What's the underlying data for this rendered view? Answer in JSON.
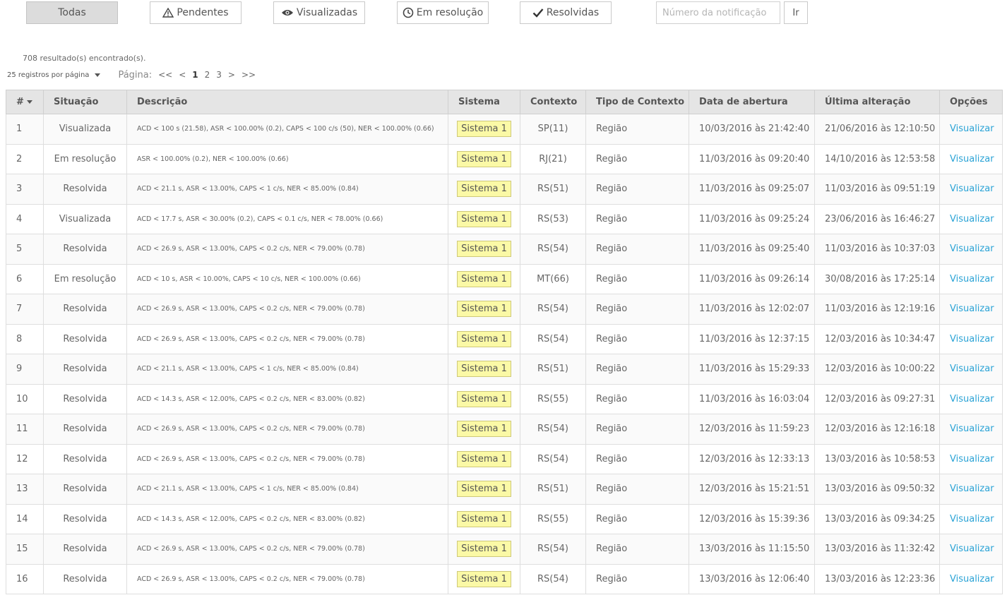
{
  "filters": {
    "todas": "Todas",
    "pendentes": "Pendentes",
    "visualizadas": "Visualizadas",
    "em_resolucao": "Em resolução",
    "resolvidas": "Resolvidas",
    "search_placeholder": "Número da notificação",
    "go_label": "Ir"
  },
  "results_text": "708 resultado(s) encontrado(s).",
  "per_page_label": "25 registros por página",
  "pagination": {
    "label": "Página:",
    "first": "<<",
    "prev": "<",
    "pages": [
      "1",
      "2",
      "3"
    ],
    "next": ">",
    "last": ">>"
  },
  "table": {
    "headers": [
      "#",
      "Situação",
      "Descrição",
      "Sistema",
      "Contexto",
      "Tipo de Contexto",
      "Data de abertura",
      "Última alteração",
      "Opções"
    ],
    "rows": [
      {
        "n": "1",
        "situacao": "Visualizada",
        "descricao": "ACD < 100 s (21.58), ASR < 100.00% (0.2), CAPS < 100 c/s (50), NER < 100.00% (0.66)",
        "sistema": "Sistema 1",
        "contexto": "SP(11)",
        "tipo": "Região",
        "abertura": "10/03/2016 às 21:42:40",
        "alteracao": "21/06/2016 às 12:10:50",
        "opcao": "Visualizar"
      },
      {
        "n": "2",
        "situacao": "Em resolução",
        "descricao": "ASR < 100.00% (0.2), NER < 100.00% (0.66)",
        "sistema": "Sistema 1",
        "contexto": "RJ(21)",
        "tipo": "Região",
        "abertura": "11/03/2016 às 09:20:40",
        "alteracao": "14/10/2016 às 12:53:58",
        "opcao": "Visualizar"
      },
      {
        "n": "3",
        "situacao": "Resolvida",
        "descricao": "ACD < 21.1 s, ASR < 13.00%, CAPS < 1 c/s, NER < 85.00% (0.84)",
        "sistema": "Sistema 1",
        "contexto": "RS(51)",
        "tipo": "Região",
        "abertura": "11/03/2016 às 09:25:07",
        "alteracao": "11/03/2016 às 09:51:19",
        "opcao": "Visualizar"
      },
      {
        "n": "4",
        "situacao": "Visualizada",
        "descricao": "ACD < 17.7 s, ASR < 30.00% (0.2), CAPS < 0.1 c/s, NER < 78.00% (0.66)",
        "sistema": "Sistema 1",
        "contexto": "RS(53)",
        "tipo": "Região",
        "abertura": "11/03/2016 às 09:25:24",
        "alteracao": "23/06/2016 às 16:46:27",
        "opcao": "Visualizar"
      },
      {
        "n": "5",
        "situacao": "Resolvida",
        "descricao": "ACD < 26.9 s, ASR < 13.00%, CAPS < 0.2 c/s, NER < 79.00% (0.78)",
        "sistema": "Sistema 1",
        "contexto": "RS(54)",
        "tipo": "Região",
        "abertura": "11/03/2016 às 09:25:40",
        "alteracao": "11/03/2016 às 10:37:03",
        "opcao": "Visualizar"
      },
      {
        "n": "6",
        "situacao": "Em resolução",
        "descricao": "ACD < 10 s, ASR < 10.00%, CAPS < 10 c/s, NER < 100.00% (0.66)",
        "sistema": "Sistema 1",
        "contexto": "MT(66)",
        "tipo": "Região",
        "abertura": "11/03/2016 às 09:26:14",
        "alteracao": "30/08/2016 às 17:25:14",
        "opcao": "Visualizar"
      },
      {
        "n": "7",
        "situacao": "Resolvida",
        "descricao": "ACD < 26.9 s, ASR < 13.00%, CAPS < 0.2 c/s, NER < 79.00% (0.78)",
        "sistema": "Sistema 1",
        "contexto": "RS(54)",
        "tipo": "Região",
        "abertura": "11/03/2016 às 12:02:07",
        "alteracao": "11/03/2016 às 12:19:16",
        "opcao": "Visualizar"
      },
      {
        "n": "8",
        "situacao": "Resolvida",
        "descricao": "ACD < 26.9 s, ASR < 13.00%, CAPS < 0.2 c/s, NER < 79.00% (0.78)",
        "sistema": "Sistema 1",
        "contexto": "RS(54)",
        "tipo": "Região",
        "abertura": "11/03/2016 às 12:37:15",
        "alteracao": "12/03/2016 às 10:34:47",
        "opcao": "Visualizar"
      },
      {
        "n": "9",
        "situacao": "Resolvida",
        "descricao": "ACD < 21.1 s, ASR < 13.00%, CAPS < 1 c/s, NER < 85.00% (0.84)",
        "sistema": "Sistema 1",
        "contexto": "RS(51)",
        "tipo": "Região",
        "abertura": "11/03/2016 às 15:29:33",
        "alteracao": "12/03/2016 às 10:00:22",
        "opcao": "Visualizar"
      },
      {
        "n": "10",
        "situacao": "Resolvida",
        "descricao": "ACD < 14.3 s, ASR < 12.00%, CAPS < 0.2 c/s, NER < 83.00% (0.82)",
        "sistema": "Sistema 1",
        "contexto": "RS(55)",
        "tipo": "Região",
        "abertura": "11/03/2016 às 16:03:04",
        "alteracao": "12/03/2016 às 09:27:31",
        "opcao": "Visualizar"
      },
      {
        "n": "11",
        "situacao": "Resolvida",
        "descricao": "ACD < 26.9 s, ASR < 13.00%, CAPS < 0.2 c/s, NER < 79.00% (0.78)",
        "sistema": "Sistema 1",
        "contexto": "RS(54)",
        "tipo": "Região",
        "abertura": "12/03/2016 às 11:59:23",
        "alteracao": "12/03/2016 às 12:16:18",
        "opcao": "Visualizar"
      },
      {
        "n": "12",
        "situacao": "Resolvida",
        "descricao": "ACD < 26.9 s, ASR < 13.00%, CAPS < 0.2 c/s, NER < 79.00% (0.78)",
        "sistema": "Sistema 1",
        "contexto": "RS(54)",
        "tipo": "Região",
        "abertura": "12/03/2016 às 12:33:13",
        "alteracao": "13/03/2016 às 10:58:53",
        "opcao": "Visualizar"
      },
      {
        "n": "13",
        "situacao": "Resolvida",
        "descricao": "ACD < 21.1 s, ASR < 13.00%, CAPS < 1 c/s, NER < 85.00% (0.84)",
        "sistema": "Sistema 1",
        "contexto": "RS(51)",
        "tipo": "Região",
        "abertura": "12/03/2016 às 15:21:51",
        "alteracao": "13/03/2016 às 09:50:32",
        "opcao": "Visualizar"
      },
      {
        "n": "14",
        "situacao": "Resolvida",
        "descricao": "ACD < 14.3 s, ASR < 12.00%, CAPS < 0.2 c/s, NER < 83.00% (0.82)",
        "sistema": "Sistema 1",
        "contexto": "RS(55)",
        "tipo": "Região",
        "abertura": "12/03/2016 às 15:39:36",
        "alteracao": "13/03/2016 às 09:34:25",
        "opcao": "Visualizar"
      },
      {
        "n": "15",
        "situacao": "Resolvida",
        "descricao": "ACD < 26.9 s, ASR < 13.00%, CAPS < 0.2 c/s, NER < 79.00% (0.78)",
        "sistema": "Sistema 1",
        "contexto": "RS(54)",
        "tipo": "Região",
        "abertura": "13/03/2016 às 11:15:50",
        "alteracao": "13/03/2016 às 11:32:42",
        "opcao": "Visualizar"
      },
      {
        "n": "16",
        "situacao": "Resolvida",
        "descricao": "ACD < 26.9 s, ASR < 13.00%, CAPS < 0.2 c/s, NER < 79.00% (0.78)",
        "sistema": "Sistema 1",
        "contexto": "RS(54)",
        "tipo": "Região",
        "abertura": "13/03/2016 às 12:06:40",
        "alteracao": "13/03/2016 às 12:23:36",
        "opcao": "Visualizar"
      }
    ]
  },
  "colors": {
    "link": "#2aa3d6",
    "badge_bg": "#fbf9a6",
    "header_bg": "#e5e5e5",
    "active_filter_bg": "#dcdcdc"
  }
}
